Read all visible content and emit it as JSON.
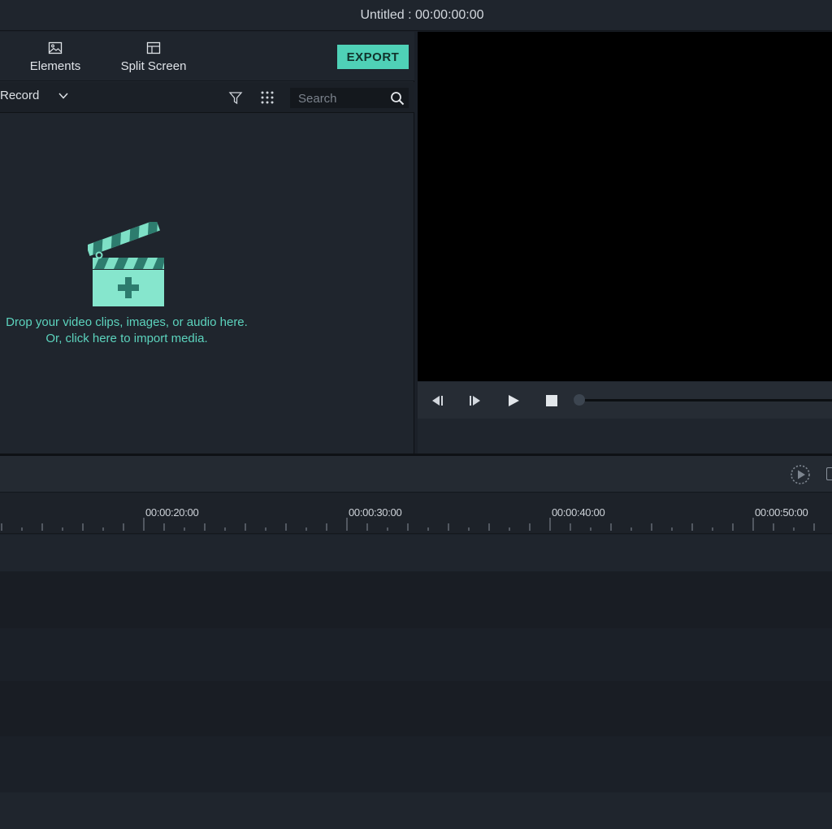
{
  "window": {
    "title": "Untitled : 00:00:00:00"
  },
  "tabs": [
    {
      "label": "Elements",
      "icon": "image-icon"
    },
    {
      "label": "Split Screen",
      "icon": "split-screen-icon"
    }
  ],
  "export_label": "EXPORT",
  "media_toolbar": {
    "record_label": "Record",
    "search_placeholder": "Search"
  },
  "dropzone": {
    "line1": "Drop your video clips, images, or audio here.",
    "line2": "Or, click here to import media."
  },
  "timeline": {
    "ruler_labels": [
      "00:00:20:00",
      "00:00:30:00",
      "00:00:40:00",
      "00:00:50:00"
    ]
  },
  "colors": {
    "accent": "#4fd1b7",
    "accent_text": "#5cd3bd",
    "panel": "#1f252d",
    "preview": "#000000"
  }
}
